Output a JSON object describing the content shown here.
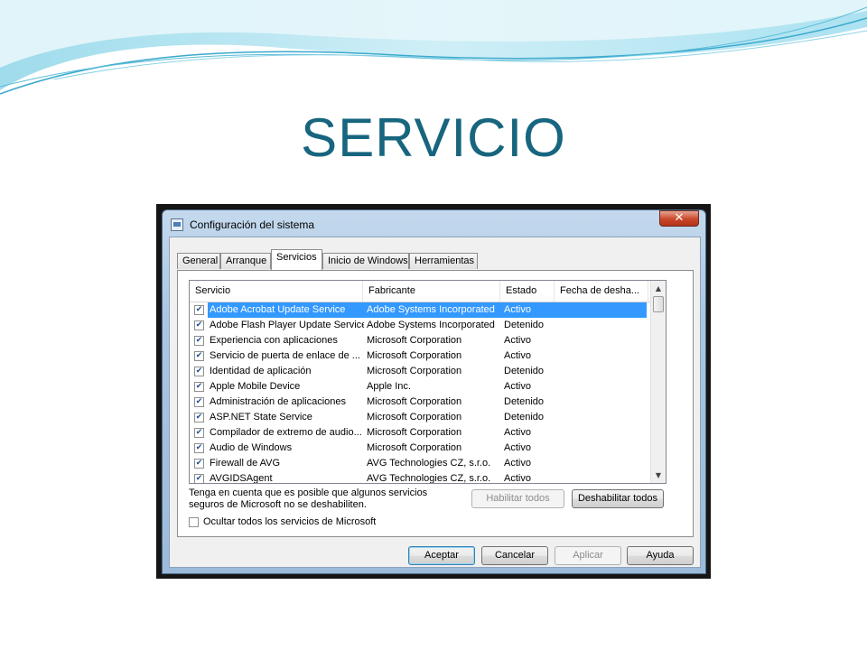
{
  "slide": {
    "title": "SERVICIO"
  },
  "window": {
    "title": "Configuración del sistema",
    "close_glyph": "✕"
  },
  "tabs": [
    {
      "label": "General"
    },
    {
      "label": "Arranque"
    },
    {
      "label": "Servicios",
      "active": true
    },
    {
      "label": "Inicio de Windows"
    },
    {
      "label": "Herramientas"
    }
  ],
  "list": {
    "columns": [
      "Servicio",
      "Fabricante",
      "Estado",
      "Fecha de desha..."
    ],
    "rows": [
      {
        "name": "Adobe Acrobat Update Service",
        "vendor": "Adobe Systems Incorporated",
        "state": "Activo",
        "checked": true,
        "selected": true
      },
      {
        "name": "Adobe Flash Player Update Service",
        "vendor": "Adobe Systems Incorporated",
        "state": "Detenido",
        "checked": true
      },
      {
        "name": "Experiencia con aplicaciones",
        "vendor": "Microsoft Corporation",
        "state": "Activo",
        "checked": true
      },
      {
        "name": "Servicio de puerta de enlace de ...",
        "vendor": "Microsoft Corporation",
        "state": "Activo",
        "checked": true
      },
      {
        "name": "Identidad de aplicación",
        "vendor": "Microsoft Corporation",
        "state": "Detenido",
        "checked": true
      },
      {
        "name": "Apple Mobile Device",
        "vendor": "Apple Inc.",
        "state": "Activo",
        "checked": true
      },
      {
        "name": "Administración de aplicaciones",
        "vendor": "Microsoft Corporation",
        "state": "Detenido",
        "checked": true
      },
      {
        "name": "ASP.NET State Service",
        "vendor": "Microsoft Corporation",
        "state": "Detenido",
        "checked": true
      },
      {
        "name": "Compilador de extremo de audio...",
        "vendor": "Microsoft Corporation",
        "state": "Activo",
        "checked": true
      },
      {
        "name": "Audio de Windows",
        "vendor": "Microsoft Corporation",
        "state": "Activo",
        "checked": true
      },
      {
        "name": "Firewall de AVG",
        "vendor": "AVG Technologies CZ, s.r.o.",
        "state": "Activo",
        "checked": true
      },
      {
        "name": "AVGIDSAgent",
        "vendor": "AVG Technologies CZ, s.r.o.",
        "state": "Activo",
        "checked": true
      }
    ],
    "check_glyph": "✔",
    "scroll_up_glyph": "▲",
    "scroll_down_glyph": "▼"
  },
  "note": "Tenga en cuenta que es posible que algunos servicios seguros de Microsoft no se deshabiliten.",
  "buttons": {
    "enable_all": "Habilitar todos",
    "disable_all": "Deshabilitar todos",
    "accept": "Aceptar",
    "cancel": "Cancelar",
    "apply": "Aplicar",
    "help": "Ayuda"
  },
  "hide_ms_label": "Ocultar todos los servicios de Microsoft",
  "hide_ms_checked": false,
  "colors": {
    "title": "#17657e",
    "selection": "#3399ff",
    "close": "#c9472b"
  }
}
